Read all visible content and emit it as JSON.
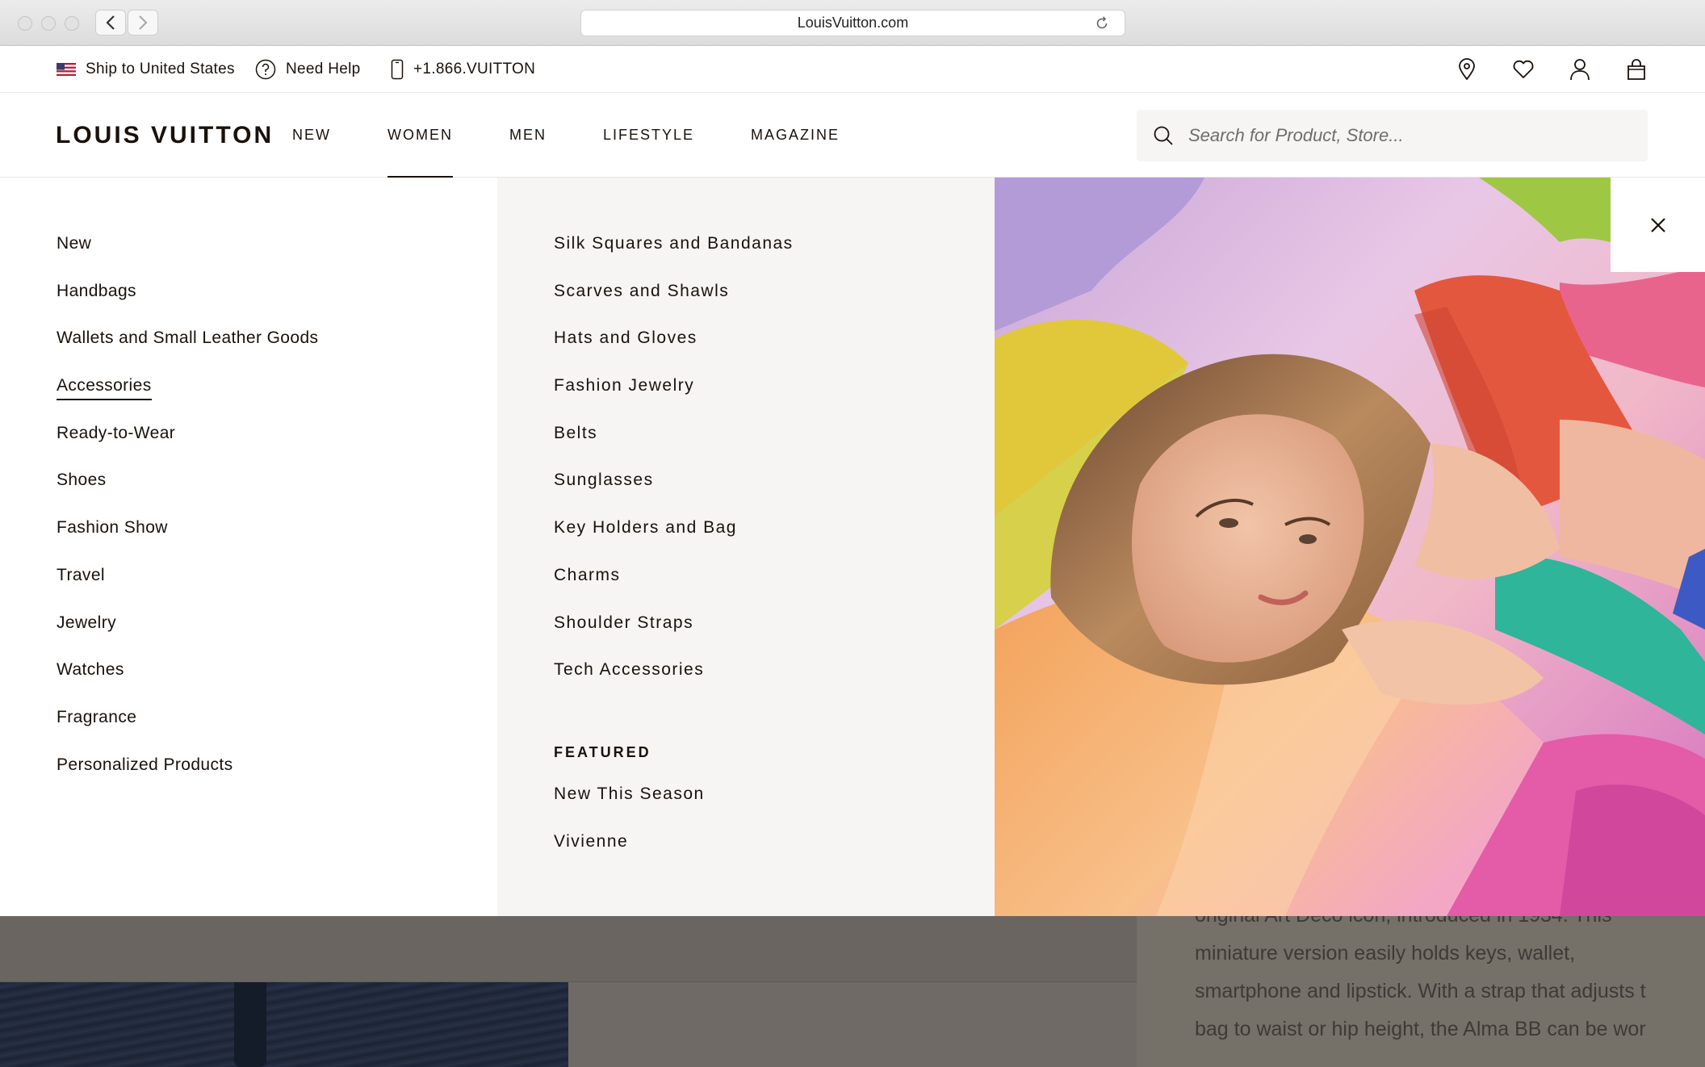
{
  "browser": {
    "url": "LouisVuitton.com"
  },
  "utility_bar": {
    "ship_to": "Ship to United States",
    "need_help": "Need Help",
    "phone": "+1.866.VUITTON"
  },
  "header": {
    "logo": "LOUIS VUITTON",
    "nav": [
      {
        "label": "NEW"
      },
      {
        "label": "WOMEN"
      },
      {
        "label": "MEN"
      },
      {
        "label": "LIFESTYLE"
      },
      {
        "label": "MAGAZINE"
      }
    ],
    "active_tab": "WOMEN",
    "search_placeholder": "Search for Product, Store..."
  },
  "menu": {
    "categories": [
      {
        "label": "New"
      },
      {
        "label": "Handbags"
      },
      {
        "label": "Wallets and Small Leather Goods"
      },
      {
        "label": "Accessories"
      },
      {
        "label": "Ready-to-Wear"
      },
      {
        "label": "Shoes"
      },
      {
        "label": "Fashion Show"
      },
      {
        "label": "Travel"
      },
      {
        "label": "Jewelry"
      },
      {
        "label": "Watches"
      },
      {
        "label": "Fragrance"
      },
      {
        "label": "Personalized Products"
      }
    ],
    "active_category": "Accessories",
    "subcategories": [
      {
        "label": "Silk Squares and Bandanas"
      },
      {
        "label": "Scarves and Shawls"
      },
      {
        "label": "Hats and Gloves"
      },
      {
        "label": "Fashion Jewelry"
      },
      {
        "label": "Belts"
      },
      {
        "label": "Sunglasses"
      },
      {
        "label": "Key Holders and Bag"
      },
      {
        "label": "Charms"
      },
      {
        "label": "Shoulder Straps"
      },
      {
        "label": "Tech Accessories"
      }
    ],
    "featured_title": "FEATURED",
    "featured": [
      {
        "label": "New This Season"
      },
      {
        "label": "Vivienne"
      }
    ]
  },
  "background_page": {
    "description_lines": [
      "original Art Deco icon, introduced in 1934. This",
      "miniature version easily holds keys, wallet,",
      "smartphone and lipstick. With a strap that adjusts the",
      "bag to waist or hip height, the Alma BB can be worn"
    ]
  },
  "colors": {
    "text": "#19110b",
    "panel_grey": "#f6f5f3",
    "overlay_dim": "#6f6a66"
  }
}
